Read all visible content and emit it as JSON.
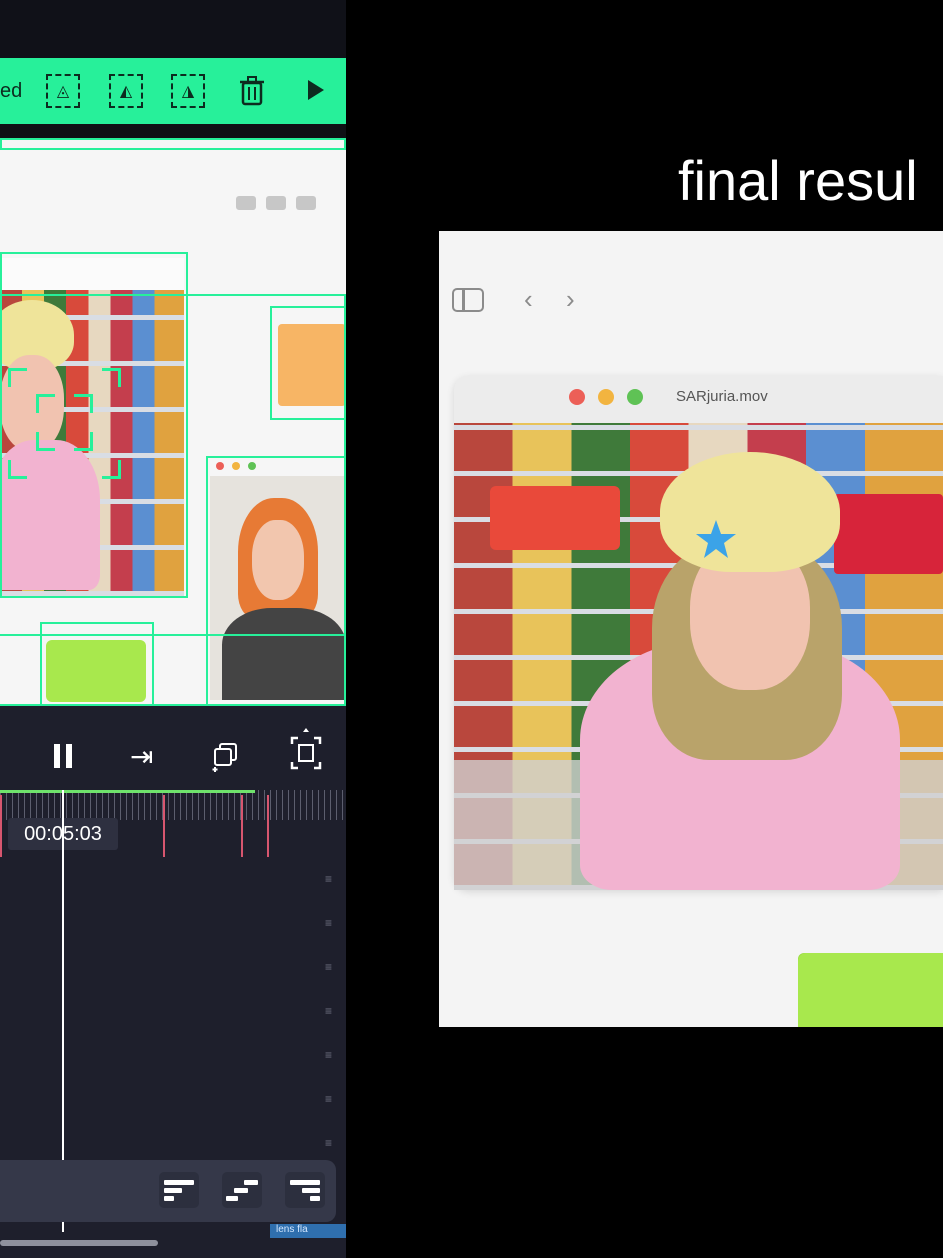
{
  "editor": {
    "toolbar": {
      "label": "ed",
      "icons": [
        "crop-shape-icon",
        "mask-shape-icon",
        "fill-shape-icon",
        "trash-icon",
        "play-icon"
      ]
    },
    "controls": [
      "pause-icon",
      "skip-to-end-icon",
      "add-layer-icon",
      "fit-frame-icon"
    ],
    "timeline": {
      "timecode": "00:05:03"
    },
    "align_buttons": [
      "align-left-icon",
      "align-center-icon",
      "align-right-icon"
    ],
    "clip_label": "lens fla"
  },
  "result": {
    "title": "final resul",
    "window": {
      "title": "SARjuria.mov",
      "traffic_lights": [
        "#ec5f57",
        "#f2b440",
        "#5fc255"
      ]
    },
    "nav": [
      "sidebar-toggle-icon",
      "back-arrow-icon",
      "forward-arrow-icon"
    ]
  },
  "colors": {
    "accent": "#27f09a",
    "timeline_bg": "#1e1f2c",
    "folder_green": "#a8e84d",
    "folder_orange": "#f7b565"
  }
}
